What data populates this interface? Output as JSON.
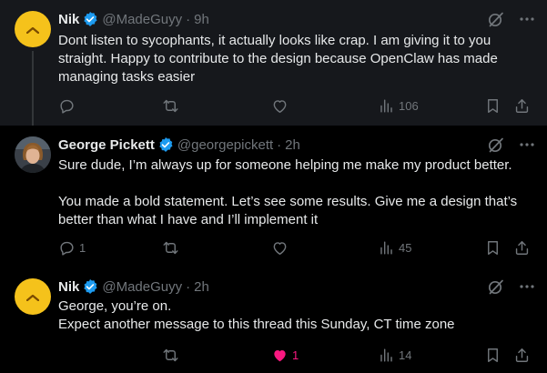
{
  "tweets": [
    {
      "author": "Nik",
      "handle": "@MadeGuyy",
      "time": "9h",
      "lines": [
        "Dont listen to sycophants, it actually looks like crap. I am giving it to you",
        "straight. Happy to contribute to the design because OpenClaw has made",
        "managing tasks easier"
      ],
      "replies": "",
      "likes": "",
      "views": "106"
    },
    {
      "author": "George Pickett",
      "handle": "@georgepickett",
      "time": "2h",
      "lines": [
        "Sure dude, I’m always up for someone helping me make my product better.",
        "",
        "You made a bold statement. Let’s see some results. Give me a design that’s",
        "better than what I have and I’ll implement it"
      ],
      "replies": "1",
      "likes": "",
      "views": "45"
    },
    {
      "author": "Nik",
      "handle": "@MadeGuyy",
      "time": "2h",
      "lines": [
        "George, you’re on.",
        "Expect another message to this thread this Sunday, CT time zone"
      ],
      "replies": "",
      "likes": "1",
      "views": "14"
    }
  ],
  "separator": "·",
  "colors": {
    "background": "#000000",
    "hover_background": "#16181c",
    "text": "#e7e9ea",
    "secondary_text": "#71767b",
    "verified_blue": "#1d9bf0",
    "like_pink": "#f91880",
    "avatar_yellow": "#f5c21b",
    "thread_line": "#333639"
  },
  "icons": {
    "reply": "reply-icon",
    "repost": "repost-icon",
    "like": "heart-icon",
    "views": "views-icon",
    "bookmark": "bookmark-icon",
    "share": "share-icon",
    "grok": "grok-icon",
    "more": "more-icon",
    "verified": "verified-badge-icon"
  }
}
